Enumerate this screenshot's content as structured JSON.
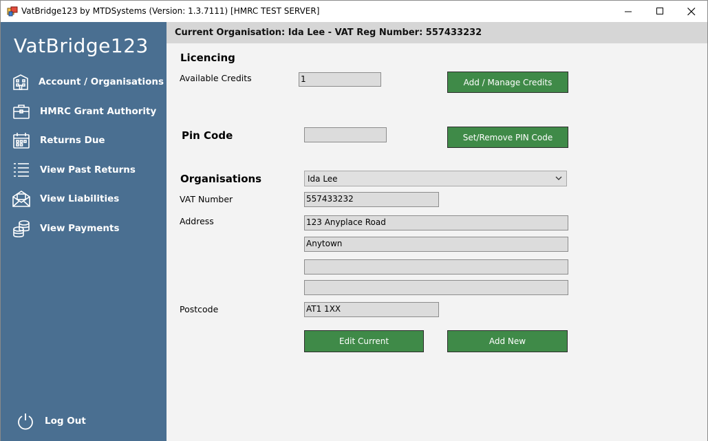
{
  "window": {
    "title": "VatBridge123 by MTDSystems (Version: 1.3.7111) [HMRC TEST SERVER]"
  },
  "sidebar": {
    "logo": "VatBridge123",
    "items": [
      {
        "label": "Account / Organisations",
        "icon": "building-icon"
      },
      {
        "label": "HMRC Grant Authority",
        "icon": "briefcase-icon"
      },
      {
        "label": "Returns Due",
        "icon": "calendar-icon"
      },
      {
        "label": "View Past Returns",
        "icon": "list-icon"
      },
      {
        "label": "View Liabilities",
        "icon": "envelope-icon"
      },
      {
        "label": "View Payments",
        "icon": "coins-icon"
      }
    ],
    "logout_label": "Log Out"
  },
  "banner": {
    "text": "Current Organisation: Ida Lee - VAT Reg Number: 557433232"
  },
  "licencing": {
    "title": "Licencing",
    "credits_label": "Available Credits",
    "credits_value": "1",
    "manage_button": "Add / Manage Credits"
  },
  "pin": {
    "title": "Pin Code",
    "value": "",
    "button": "Set/Remove PIN Code"
  },
  "organisations": {
    "title": "Organisations",
    "selected": "Ida Lee",
    "vat_label": "VAT Number",
    "vat_value": "557433232",
    "address_label": "Address",
    "address_lines": [
      "123 Anyplace Road",
      "Anytown",
      "",
      ""
    ],
    "postcode_label": "Postcode",
    "postcode_value": "AT1 1XX",
    "edit_button": "Edit Current",
    "add_button": "Add New"
  },
  "colors": {
    "sidebar": "#4a6f91",
    "button_green": "#3f8a48",
    "banner": "#d6d6d6",
    "content_bg": "#f3f3f3"
  }
}
